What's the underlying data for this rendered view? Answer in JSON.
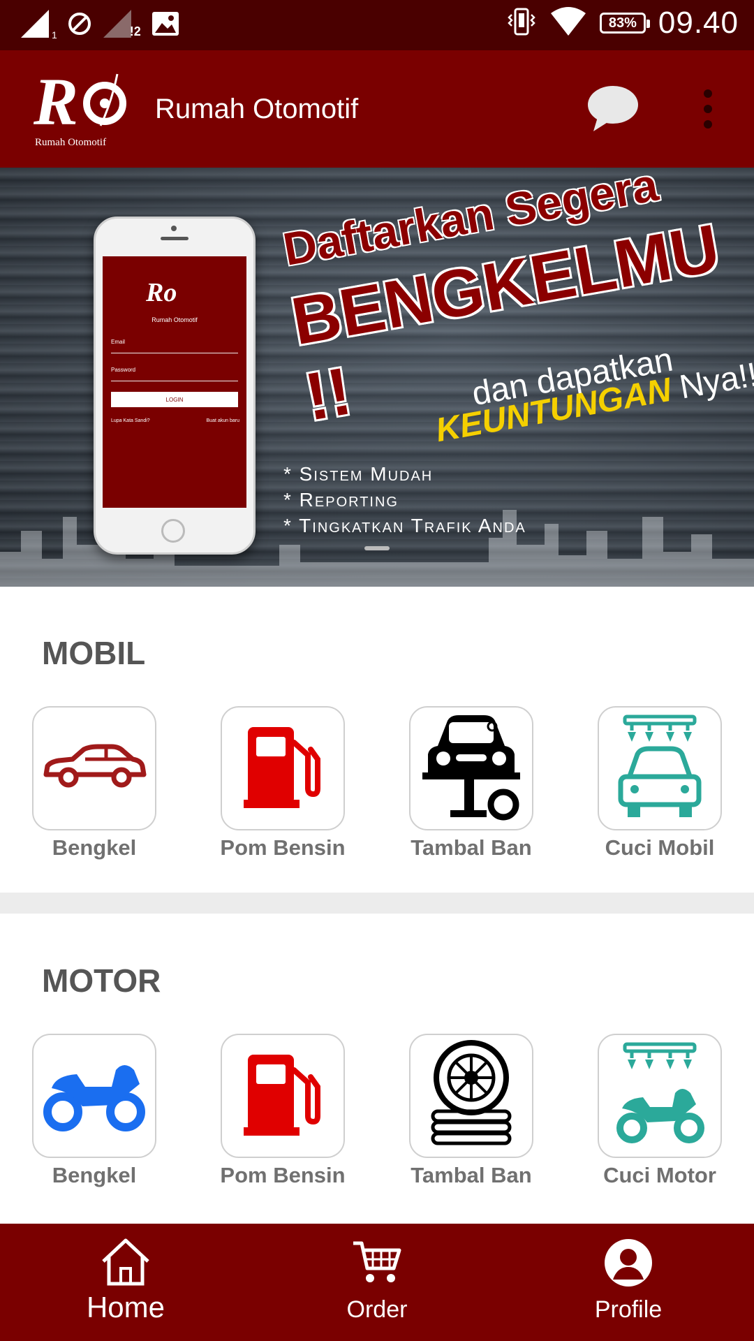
{
  "status_bar": {
    "time": "09.40",
    "battery": "83%",
    "sim1_badge": "1",
    "sim2_badge": "!2"
  },
  "app_bar": {
    "title": "Rumah Otomotif",
    "logo_text": "Rumah Otomotif",
    "icons": [
      "chat-icon",
      "overflow-menu-icon"
    ]
  },
  "banner": {
    "line1": "Daftarkan Segera",
    "line2": "BENGKELMU !!",
    "line3": "dan dapatkan",
    "line4_highlight": "KEUNTUNGAN",
    "line4_rest": "Nya!!",
    "bullets": [
      "* Sistem Mudah",
      "* Reporting",
      "* Tingkatkan Trafik Anda"
    ],
    "phone_screen": {
      "email_label": "Email",
      "password_label": "Password",
      "login_button": "LOGIN",
      "forgot_link": "Lupa Kata Sandi?",
      "register_link": "Buat akun baru",
      "brand": "Rumah Otomotif"
    }
  },
  "mobil": {
    "title": "MOBIL",
    "items": [
      {
        "label": "Bengkel",
        "icon": "car-icon",
        "color": "#a01a1a"
      },
      {
        "label": "Pom Bensin",
        "icon": "fuel-pump-icon",
        "color": "#e00000"
      },
      {
        "label": "Tambal Ban",
        "icon": "car-lift-icon",
        "color": "#000000"
      },
      {
        "label": "Cuci Mobil",
        "icon": "car-wash-icon",
        "color": "#2ba99a"
      }
    ]
  },
  "motor": {
    "title": "MOTOR",
    "items": [
      {
        "label": "Bengkel",
        "icon": "motorcycle-icon",
        "color": "#1a6ef0"
      },
      {
        "label": "Pom Bensin",
        "icon": "fuel-pump-icon",
        "color": "#e00000"
      },
      {
        "label": "Tambal Ban",
        "icon": "tire-icon",
        "color": "#000000"
      },
      {
        "label": "Cuci Motor",
        "icon": "motor-wash-icon",
        "color": "#2ba99a"
      }
    ]
  },
  "bottom_nav": {
    "items": [
      {
        "label": "Home",
        "icon": "home-icon"
      },
      {
        "label": "Order",
        "icon": "cart-icon"
      },
      {
        "label": "Profile",
        "icon": "profile-icon"
      }
    ]
  },
  "colors": {
    "status_bar": "#4a0000",
    "primary": "#7a0000",
    "label_gray": "#707070"
  }
}
